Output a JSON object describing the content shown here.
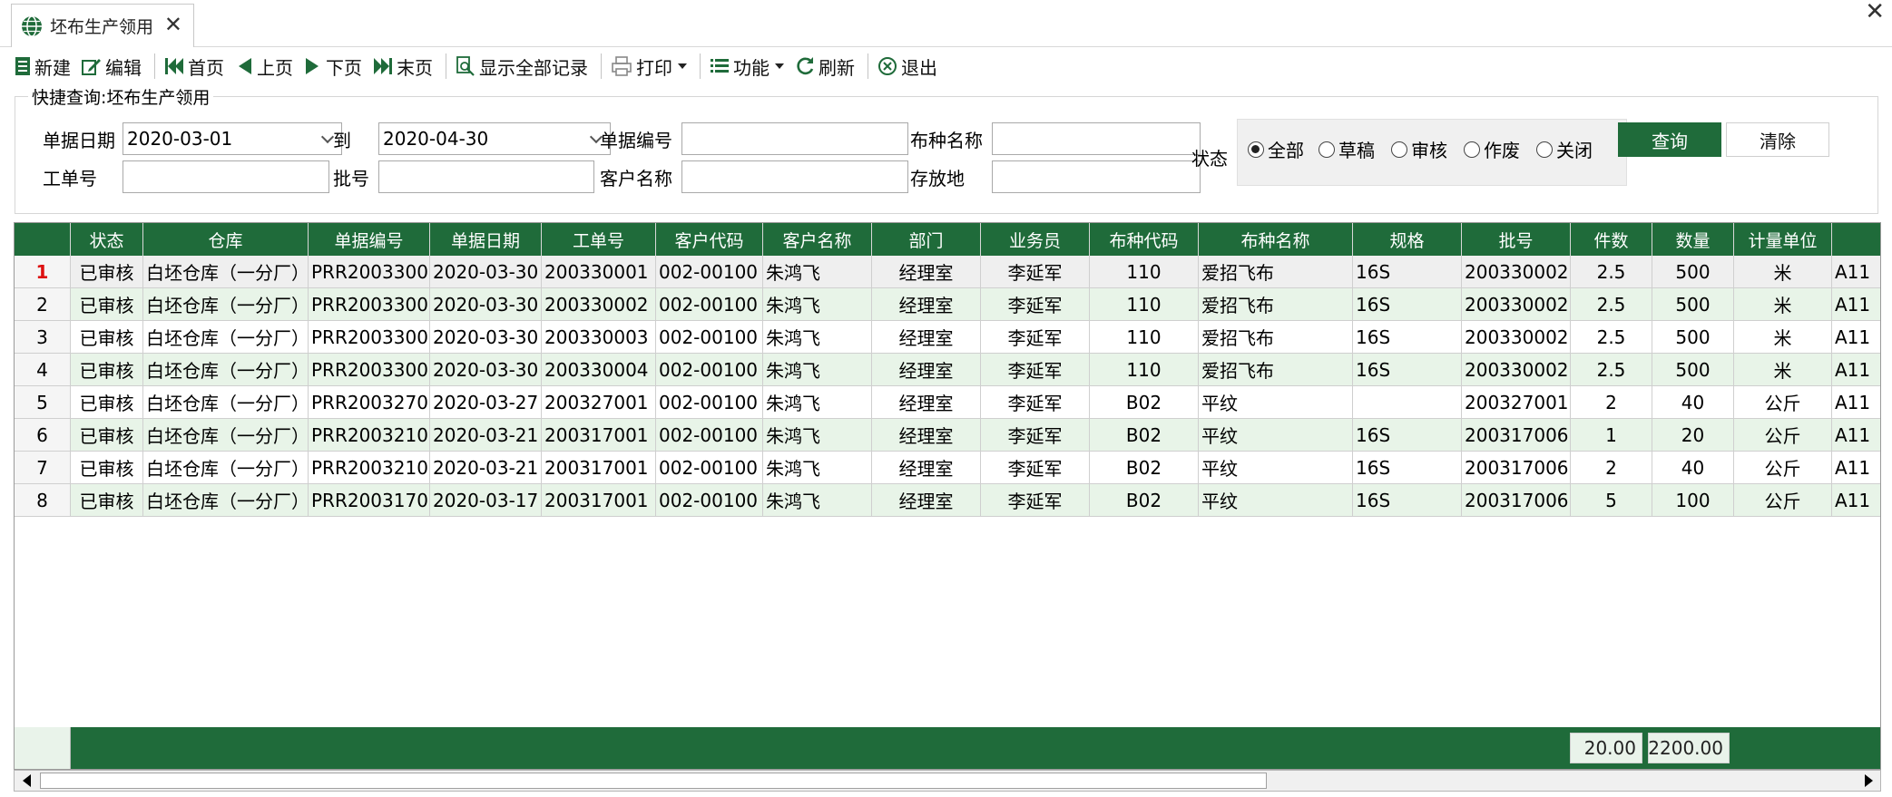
{
  "tab": {
    "title": "坯布生产领用",
    "close": "✕"
  },
  "window": {
    "close": "✕"
  },
  "toolbar": {
    "new": "新建",
    "edit": "编辑",
    "first": "首页",
    "prev": "上页",
    "next": "下页",
    "last": "末页",
    "show_all": "显示全部记录",
    "print": "打印",
    "func": "功能",
    "refresh": "刷新",
    "exit": "退出"
  },
  "search": {
    "legend": "快捷查询:坯布生产领用",
    "date_label": "单据日期",
    "date_from": "2020-03-01",
    "to_label": "到",
    "date_to": "2020-04-30",
    "docno_label": "单据编号",
    "docno": "",
    "fabric_label": "布种名称",
    "fabric": "",
    "workorder_label": "工单号",
    "workorder": "",
    "batch_label": "批号",
    "batch": "",
    "customer_label": "客户名称",
    "customer": "",
    "location_label": "存放地",
    "location": "",
    "status_label": "状态",
    "status_options": [
      "全部",
      "草稿",
      "审核",
      "作废",
      "关闭"
    ],
    "status_selected": "全部",
    "query": "查询",
    "clear": "清除"
  },
  "grid": {
    "columns": [
      "状态",
      "仓库",
      "单据编号",
      "单据日期",
      "工单号",
      "客户代码",
      "客户名称",
      "部门",
      "业务员",
      "布种代码",
      "布种名称",
      "规格",
      "批号",
      "件数",
      "数量",
      "计量单位",
      ""
    ],
    "rows": [
      [
        "1",
        "已审核",
        "白坯仓库（一分厂）",
        "PRR2003300",
        "2020-03-30",
        "200330001",
        "002-00100",
        "朱鸿飞",
        "经理室",
        "李延军",
        "110",
        "爱招飞布",
        "16S",
        "200330002",
        "2.5",
        "500",
        "米",
        "A11"
      ],
      [
        "2",
        "已审核",
        "白坯仓库（一分厂）",
        "PRR2003300",
        "2020-03-30",
        "200330002",
        "002-00100",
        "朱鸿飞",
        "经理室",
        "李延军",
        "110",
        "爱招飞布",
        "16S",
        "200330002",
        "2.5",
        "500",
        "米",
        "A11"
      ],
      [
        "3",
        "已审核",
        "白坯仓库（一分厂）",
        "PRR2003300",
        "2020-03-30",
        "200330003",
        "002-00100",
        "朱鸿飞",
        "经理室",
        "李延军",
        "110",
        "爱招飞布",
        "16S",
        "200330002",
        "2.5",
        "500",
        "米",
        "A11"
      ],
      [
        "4",
        "已审核",
        "白坯仓库（一分厂）",
        "PRR2003300",
        "2020-03-30",
        "200330004",
        "002-00100",
        "朱鸿飞",
        "经理室",
        "李延军",
        "110",
        "爱招飞布",
        "16S",
        "200330002",
        "2.5",
        "500",
        "米",
        "A11"
      ],
      [
        "5",
        "已审核",
        "白坯仓库（一分厂）",
        "PRR2003270",
        "2020-03-27",
        "200327001",
        "002-00100",
        "朱鸿飞",
        "经理室",
        "李延军",
        "B02",
        "平纹",
        "",
        "200327001",
        "2",
        "40",
        "公斤",
        "A11"
      ],
      [
        "6",
        "已审核",
        "白坯仓库（一分厂）",
        "PRR2003210",
        "2020-03-21",
        "200317001",
        "002-00100",
        "朱鸿飞",
        "经理室",
        "李延军",
        "B02",
        "平纹",
        "16S",
        "200317006",
        "1",
        "20",
        "公斤",
        "A11"
      ],
      [
        "7",
        "已审核",
        "白坯仓库（一分厂）",
        "PRR2003210",
        "2020-03-21",
        "200317001",
        "002-00100",
        "朱鸿飞",
        "经理室",
        "李延军",
        "B02",
        "平纹",
        "16S",
        "200317006",
        "2",
        "40",
        "公斤",
        "A11"
      ],
      [
        "8",
        "已审核",
        "白坯仓库（一分厂）",
        "PRR2003170",
        "2020-03-17",
        "200317001",
        "002-00100",
        "朱鸿飞",
        "经理室",
        "李延军",
        "B02",
        "平纹",
        "16S",
        "200317006",
        "5",
        "100",
        "公斤",
        "A11"
      ]
    ],
    "totals": {
      "pieces": "20.00",
      "quantity": "2200.00"
    }
  },
  "colors": {
    "accent": "#1f6b3a",
    "row_alt": "#e8f4e8"
  }
}
